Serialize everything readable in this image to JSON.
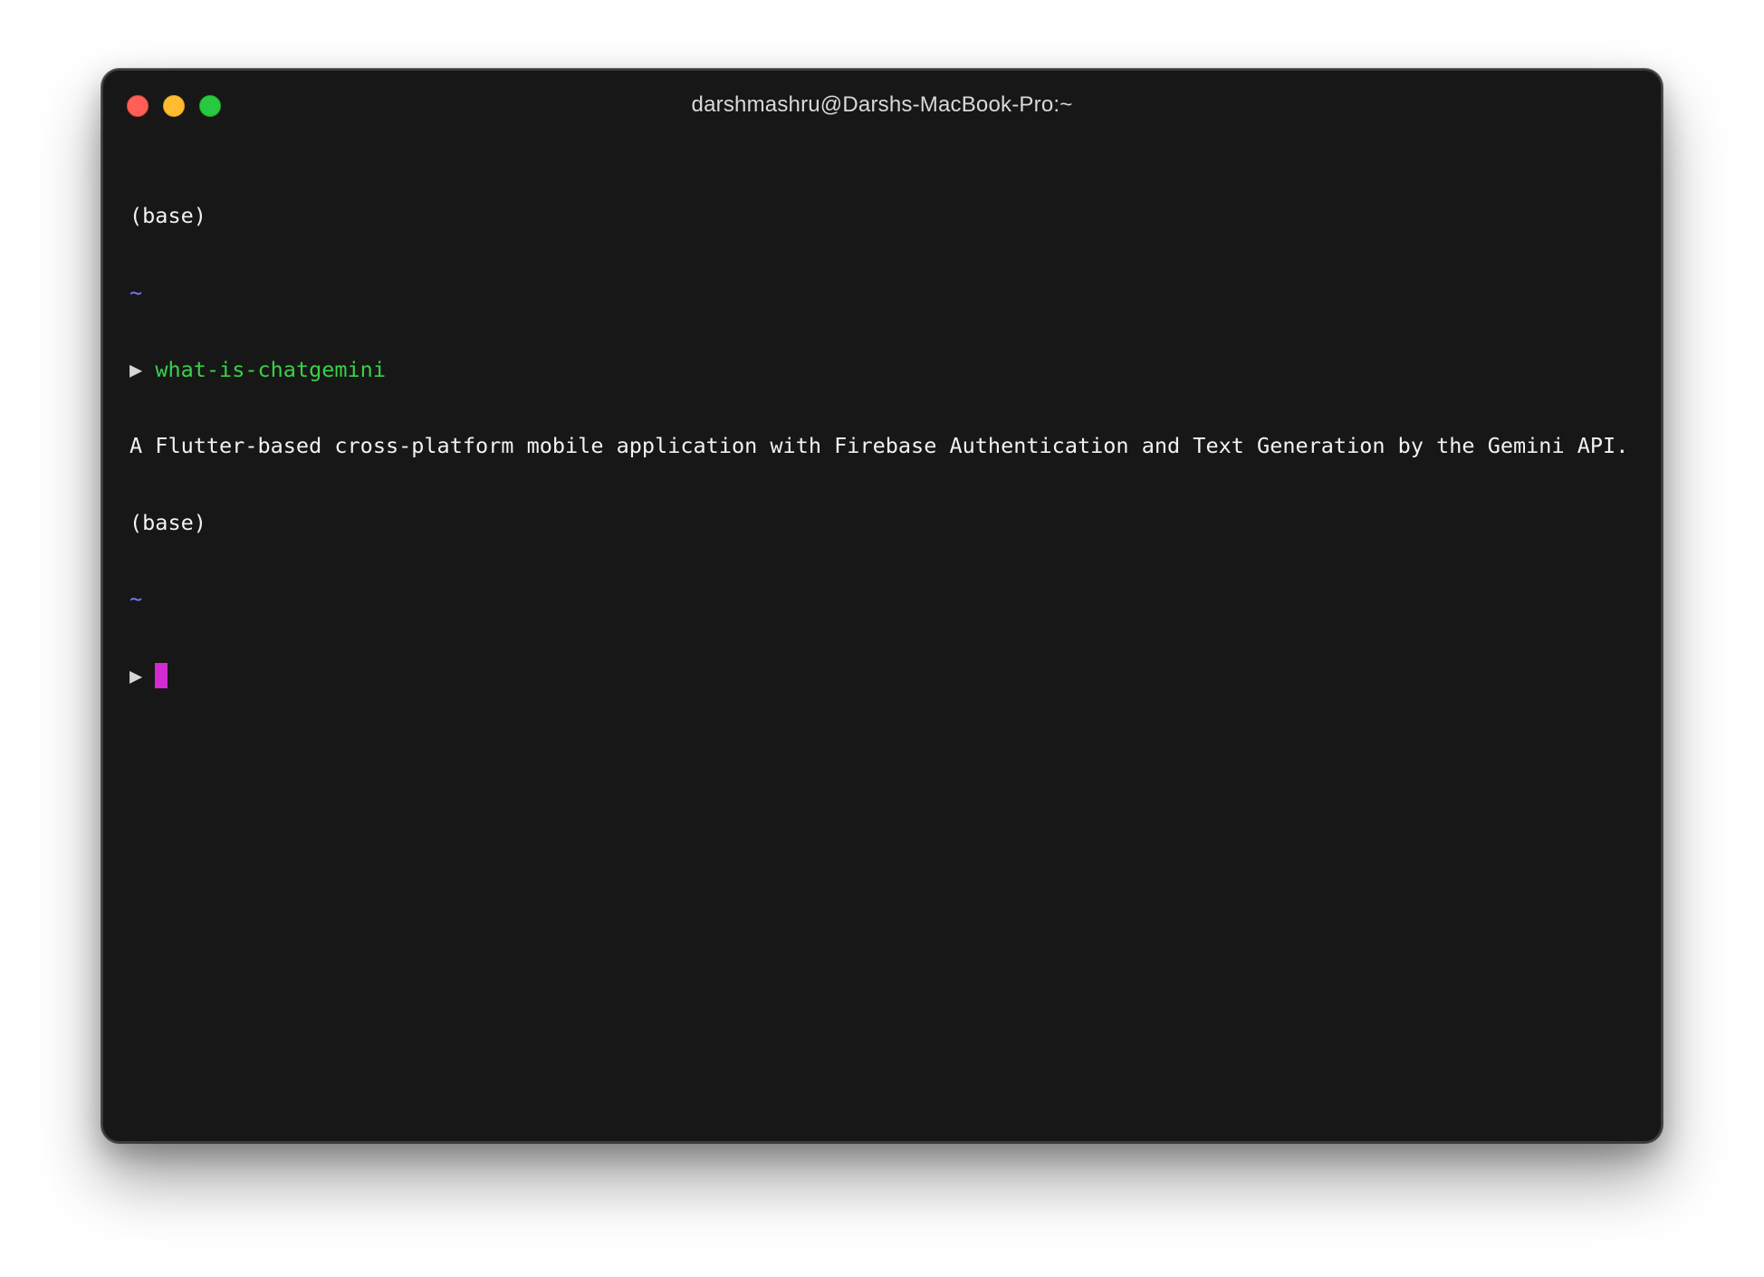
{
  "window": {
    "title": "darshmashru@Darshs-MacBook-Pro:~"
  },
  "terminal": {
    "lines": [
      {
        "env": "(base)"
      },
      {
        "cwd": "~"
      },
      {
        "prompt_symbol": "▶",
        "command": "what-is-chatgemini"
      },
      {
        "output": "A Flutter-based cross-platform mobile application with Firebase Authentication and Text Generation by the Gemini API."
      },
      {
        "env": "(base)"
      },
      {
        "cwd": "~"
      },
      {
        "prompt_symbol": "▶",
        "command": ""
      }
    ]
  },
  "colors": {
    "background": "#171717",
    "text": "#f2f2f2",
    "cwd": "#7a7cff",
    "command": "#38d14a",
    "cursor": "#d12bd1",
    "close_button": "#ff5f57",
    "minimize_button": "#febc2e",
    "zoom_button": "#28c840"
  },
  "icons": {
    "close": "close-button-red-circle",
    "minimize": "minimize-button-yellow-circle",
    "zoom": "zoom-button-green-circle",
    "prompt": "prompt-arrow-icon",
    "cursor": "block-cursor"
  }
}
